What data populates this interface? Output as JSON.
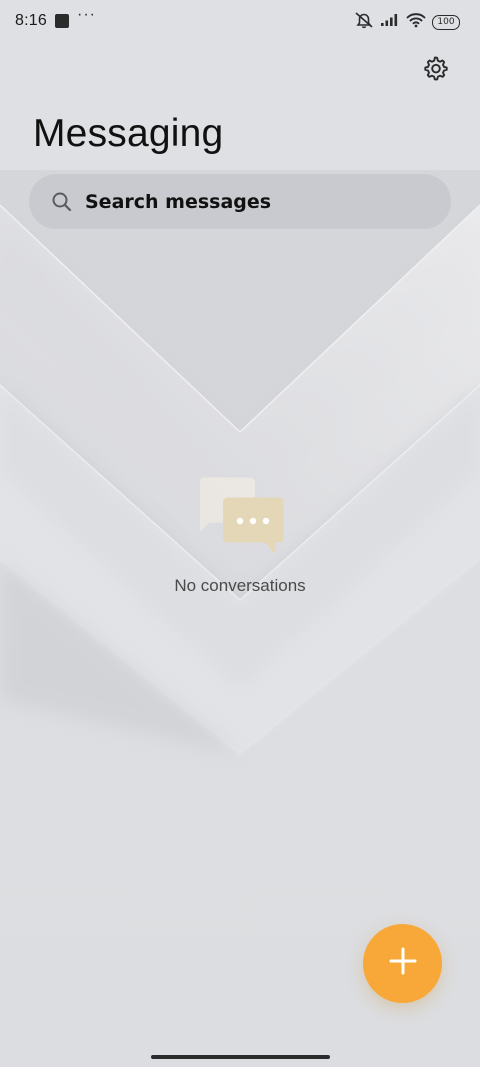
{
  "status_bar": {
    "time": "8:16",
    "more": "···",
    "battery": "100"
  },
  "header": {
    "title": "Messaging"
  },
  "search": {
    "placeholder": "Search messages"
  },
  "empty_state": {
    "text": "No conversations"
  },
  "icons": {
    "settings": "gear-icon",
    "search": "search-icon",
    "compose": "plus-icon",
    "empty": "chat-bubbles-icon",
    "mute": "bell-muted-icon",
    "signal": "signal-icon",
    "wifi": "wifi-icon",
    "battery": "battery-icon"
  },
  "colors": {
    "accent": "#f8a838",
    "background": "#dcdde1"
  }
}
